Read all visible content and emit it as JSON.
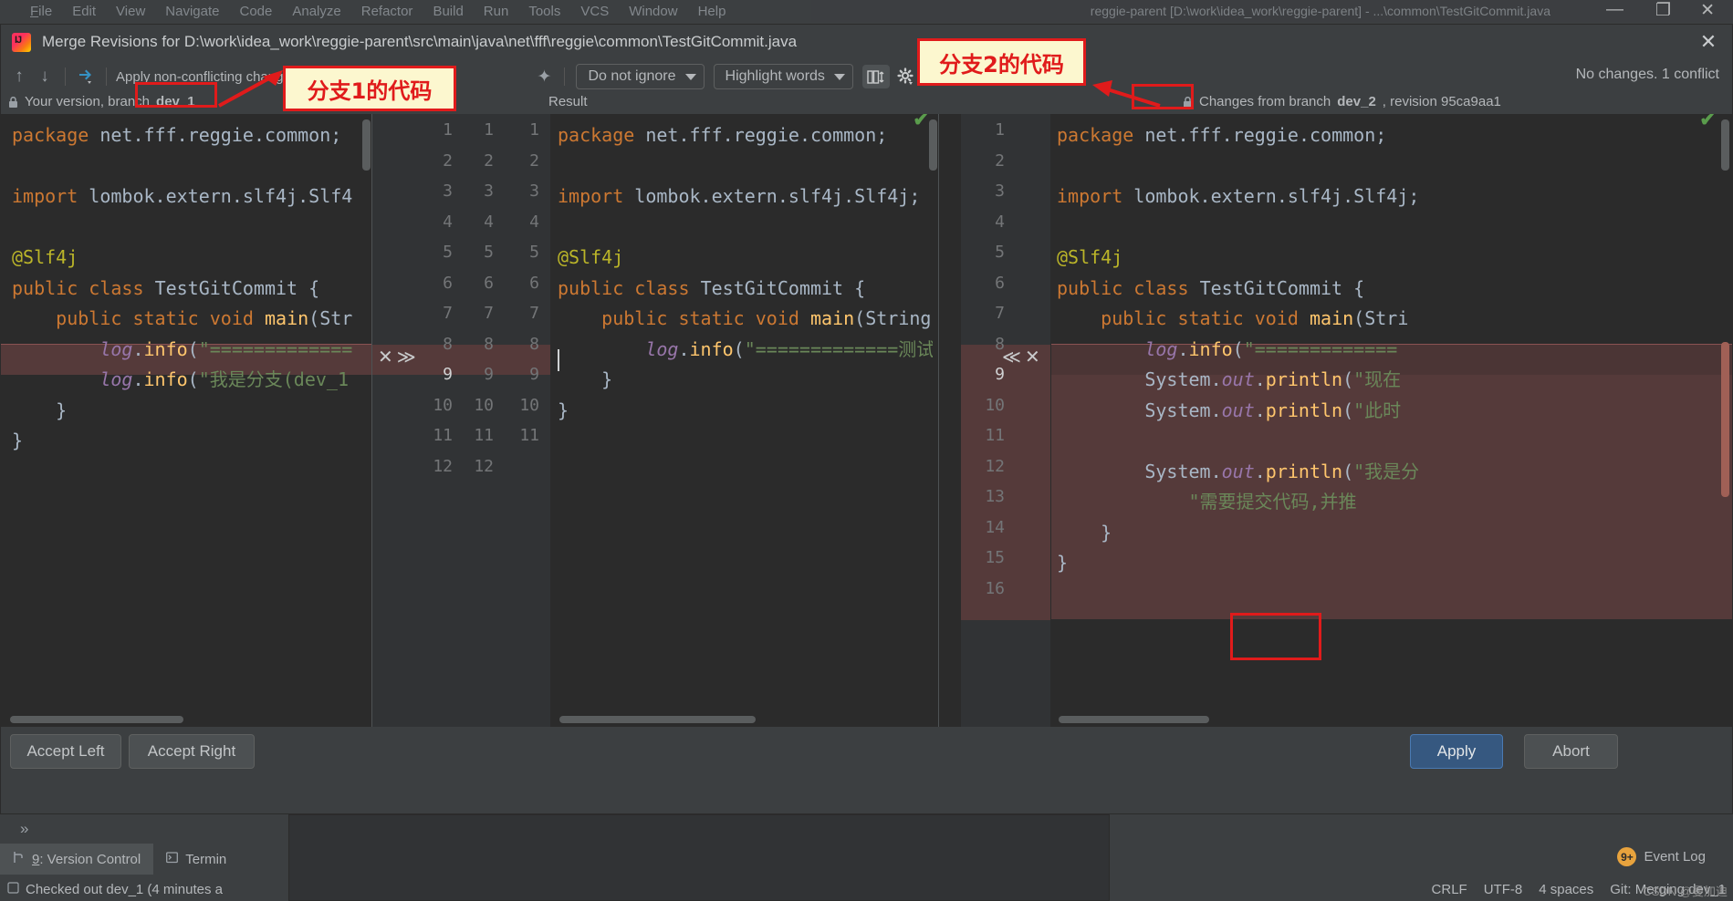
{
  "ide": {
    "menu": [
      "File",
      "Edit",
      "View",
      "Navigate",
      "Code",
      "Analyze",
      "Refactor",
      "Build",
      "Run",
      "Tools",
      "VCS",
      "Window",
      "Help"
    ],
    "project_title": "reggie-parent [D:\\work\\idea_work\\reggie-parent] - ...\\common\\TestGitCommit.java",
    "window_controls": {
      "minimize": "—",
      "maximize": "❐",
      "close": "✕"
    }
  },
  "dialog": {
    "icon": "intellij-idea-icon",
    "title": "Merge Revisions for D:\\work\\idea_work\\reggie-parent\\src\\main\\java\\net\\fff\\reggie\\common\\TestGitCommit.java",
    "close_label": "✕"
  },
  "toolbar": {
    "prev_diff_icon": "arrow-up-icon",
    "next_diff_icon": "arrow-down-icon",
    "apply_icon": "apply-non-conflicting-icon",
    "apply_label": "Apply non-conflicting changes:",
    "magic_icon": "magic-wand-icon",
    "ignore_policy": "Do not ignore",
    "highlight_policy": "Highlight words",
    "columns_icon": "side-by-side-viewer-icon",
    "settings_icon": "gear-icon",
    "help_icon": "help-icon",
    "status": "No changes. 1 conflict"
  },
  "panes": {
    "left": {
      "header_lock_icon": "lock-icon",
      "header": "Your version, branch ",
      "header_branch": "dev_1",
      "line_numbers": [
        "1",
        "2",
        "3",
        "4",
        "5",
        "6",
        "7",
        "8",
        "9",
        "10",
        "11",
        "12"
      ],
      "lines": [
        "package net.fff.reggie.common;",
        "",
        "import lombok.extern.slf4j.Slf4",
        "",
        "@Slf4j",
        "public class TestGitCommit {",
        "    public static void main(Str",
        "        log.info(\"=============",
        "        log.info(\"我是分支(dev_1",
        "    }",
        "}",
        ""
      ],
      "conflict_line_index": 8,
      "accept_icons": [
        "✕",
        "≫"
      ],
      "conflict_line_number": "9"
    },
    "center": {
      "header": "Result",
      "line_numbers_left": [
        "1",
        "2",
        "3",
        "4",
        "5",
        "6",
        "7",
        "8",
        "9",
        "10",
        "11",
        "12"
      ],
      "line_numbers_right": [
        "1",
        "2",
        "3",
        "4",
        "5",
        "6",
        "7",
        "8",
        "9",
        "10",
        "11"
      ],
      "lines": [
        "package net.fff.reggie.common;",
        "",
        "import lombok.extern.slf4j.Slf4j;",
        "",
        "@Slf4j",
        "public class TestGitCommit {",
        "    public static void main(String",
        "        log.info(\"=============测试",
        "    }",
        "}",
        ""
      ],
      "caret_line_index": 8,
      "ok_check": "✔"
    },
    "right": {
      "header_lock_icon": "lock-icon",
      "header": "Changes from branch ",
      "header_branch": "dev_2",
      "header_tail": ", revision 95ca9aa1",
      "line_numbers": [
        "1",
        "2",
        "3",
        "4",
        "5",
        "6",
        "7",
        "8",
        "9",
        "10",
        "11",
        "12",
        "13",
        "14",
        "15",
        "16"
      ],
      "lines": [
        "package net.fff.reggie.common;",
        "",
        "import lombok.extern.slf4j.Slf4j;",
        "",
        "@Slf4j",
        "public class TestGitCommit {",
        "    public static void main(Stri",
        "        log.info(\"=============",
        "        System.out.println(\"现在",
        "        System.out.println(\"此时",
        "",
        "        System.out.println(\"我是分",
        "            \"需要提交代码,并推",
        "    }",
        "}",
        ""
      ],
      "conflict_start_index": 8,
      "conflict_end_index": 12,
      "accept_icons": [
        "≪",
        "✕"
      ],
      "conflict_line_number": "9",
      "ok_check": "✔"
    }
  },
  "footer": {
    "accept_left": "Accept Left",
    "accept_right": "Accept Right",
    "apply": "Apply",
    "abort": "Abort"
  },
  "bottom": {
    "collapse_icon": "chevron-double-right-icon",
    "tabs": [
      {
        "icon": "vcs-branch-icon",
        "prefix": "9",
        "label": ": Version Control",
        "active": true
      },
      {
        "icon": "terminal-icon",
        "prefix": "",
        "label": "Termin",
        "active": false
      }
    ],
    "event_log": {
      "badge": "9+",
      "label": "Event Log"
    },
    "status_left_icon": "vcs-icon",
    "status_left": "Checked out dev_1 (4 minutes a",
    "status_right": [
      "CRLF",
      "UTF-8",
      "4 spaces",
      "Git: Merging dev_1"
    ],
    "watermark": "CSDN @曼加迪"
  },
  "annotations": {
    "note_branch1": "分支1的代码",
    "note_branch2": "分支2的代码",
    "box_color": "#e01b1b",
    "note_bg": "#fcf7cf"
  }
}
